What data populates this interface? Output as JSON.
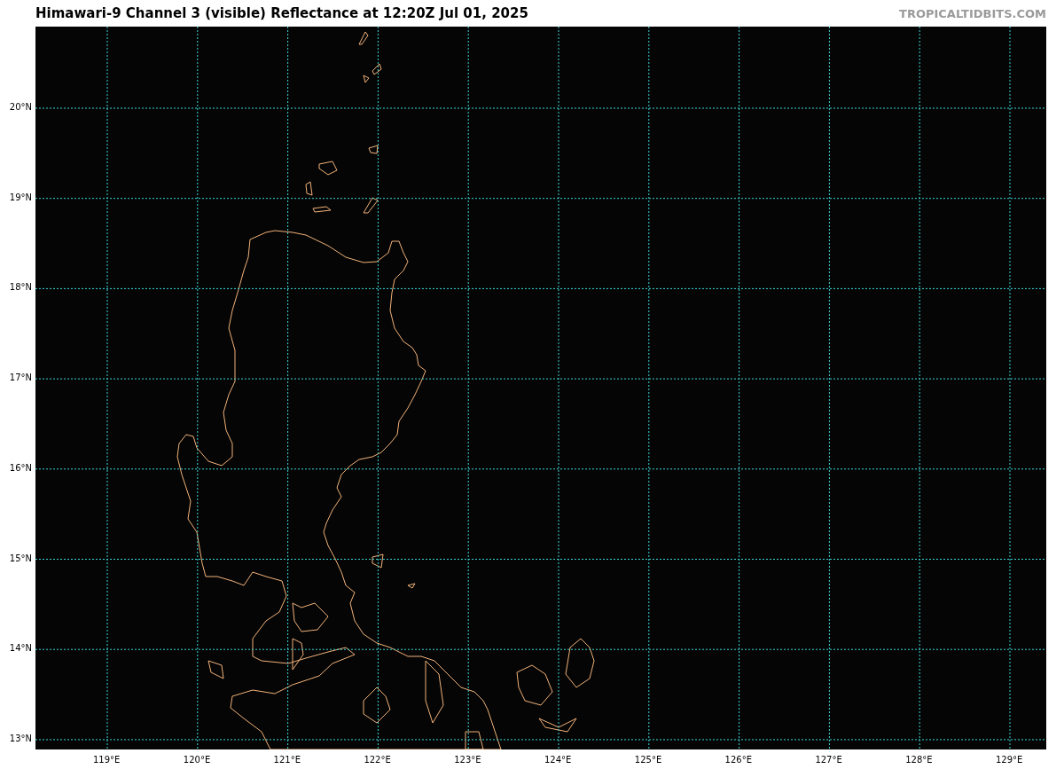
{
  "title": "Himawari-9 Channel 3 (visible) Reflectance at 12:20Z Jul 01, 2025",
  "credit": "TROPICALTIDBITS.COM",
  "map": {
    "lat_labels": [
      "20°N",
      "19°N",
      "18°N",
      "17°N",
      "16°N",
      "15°N",
      "14°N",
      "13°N"
    ],
    "lon_labels": [
      "119°E",
      "120°E",
      "121°E",
      "122°E",
      "123°E",
      "124°E",
      "125°E",
      "126°E",
      "127°E",
      "128°E",
      "129°E"
    ]
  }
}
